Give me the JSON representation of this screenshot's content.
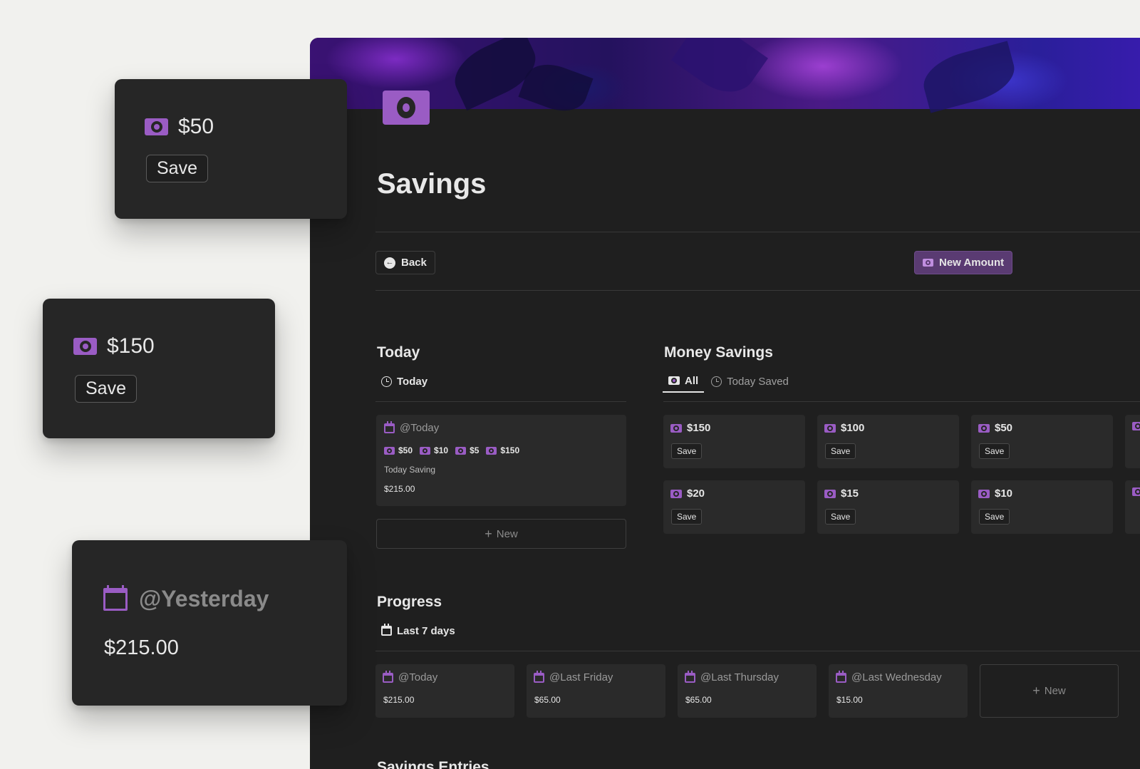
{
  "page": {
    "title": "Savings",
    "back_label": "Back",
    "new_amount_label": "New Amount"
  },
  "today_section": {
    "heading": "Today",
    "view_tab": "Today",
    "card": {
      "date": "@Today",
      "tags": [
        "$50",
        "$10",
        "$5",
        "$150"
      ],
      "caption": "Today Saving",
      "total": "$215.00"
    },
    "new_label": "New"
  },
  "money_savings": {
    "heading": "Money Savings",
    "tabs": [
      "All",
      "Today Saved"
    ],
    "active_tab": "All",
    "save_label": "Save",
    "amounts": [
      "$150",
      "$100",
      "$50",
      "$20",
      "$15",
      "$10"
    ]
  },
  "progress": {
    "heading": "Progress",
    "view_tab": "Last 7 days",
    "entries": [
      {
        "date": "@Today",
        "total": "$215.00"
      },
      {
        "date": "@Last Friday",
        "total": "$65.00"
      },
      {
        "date": "@Last Thursday",
        "total": "$65.00"
      },
      {
        "date": "@Last Wednesday",
        "total": "$15.00"
      }
    ],
    "new_label": "New"
  },
  "next_section": {
    "heading": "Savings Entries"
  },
  "floating_cards": {
    "card1": {
      "amount": "$50",
      "save_label": "Save"
    },
    "card2": {
      "amount": "$150",
      "save_label": "Save"
    },
    "card3": {
      "date": "@Yesterday",
      "total": "$215.00"
    }
  },
  "colors": {
    "accent": "#9a5cc4",
    "panel_bg": "#1f1f1f",
    "card_bg": "#2a2a2a",
    "page_bg": "#f1f1ee"
  },
  "icons": [
    "money-bill-icon",
    "calendar-icon",
    "clock-icon",
    "arrow-left-circle-icon",
    "plus-icon"
  ]
}
